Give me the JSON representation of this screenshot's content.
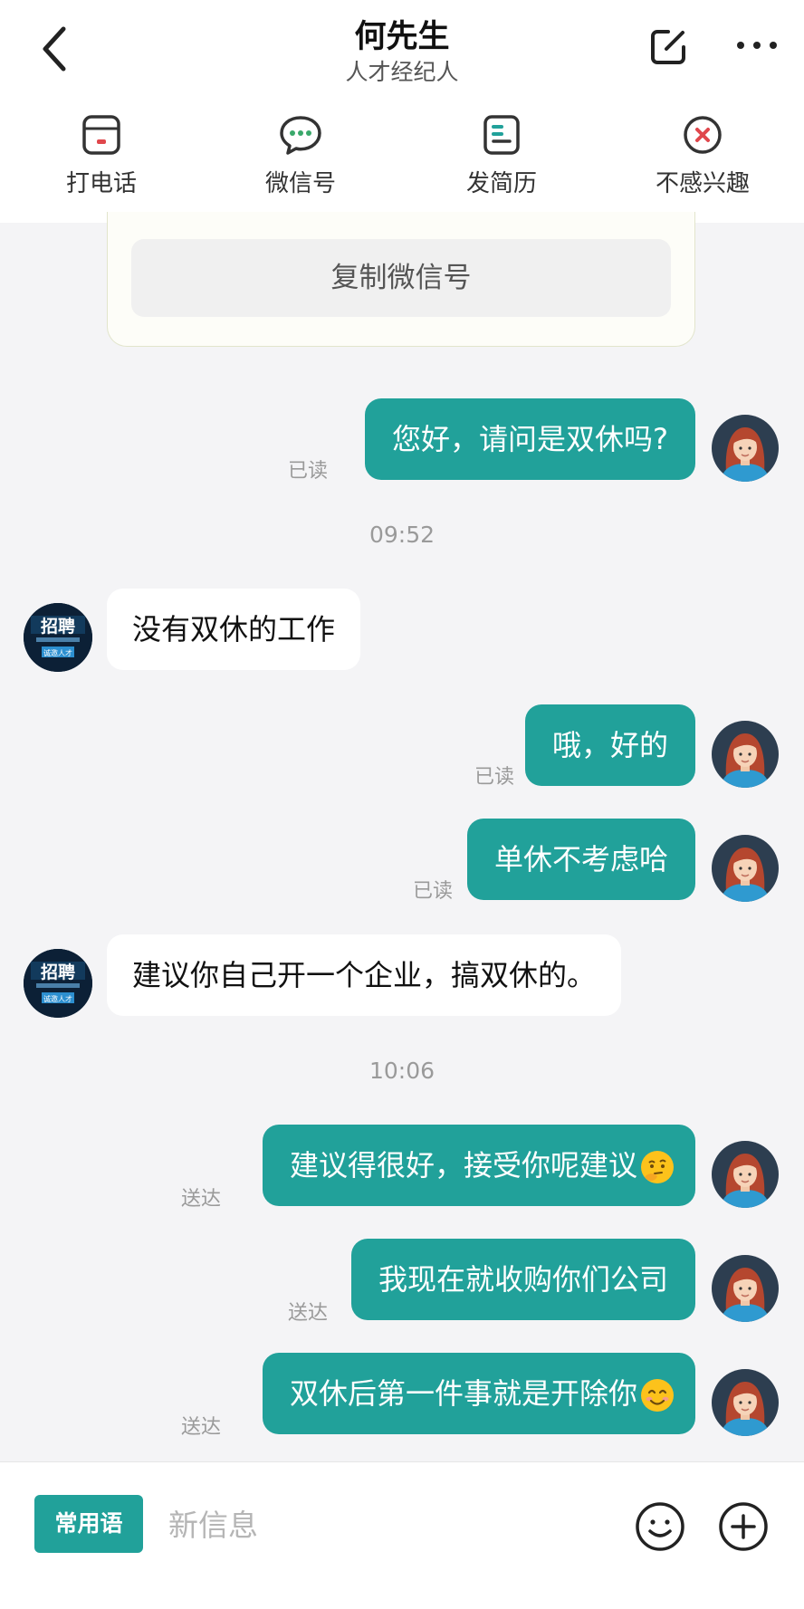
{
  "header": {
    "title": "何先生",
    "subtitle": "人才经纪人"
  },
  "actions": [
    {
      "label": "打电话",
      "icon": "phone-card-icon"
    },
    {
      "label": "微信号",
      "icon": "chat-bubble-icon"
    },
    {
      "label": "发简历",
      "icon": "resume-icon"
    },
    {
      "label": "不感兴趣",
      "icon": "not-interested-icon"
    }
  ],
  "card": {
    "copy_label": "复制微信号"
  },
  "messages": [
    {
      "text": "您好，请问是双休吗?",
      "status": "已读"
    },
    {
      "time": "09:52"
    },
    {
      "text": "没有双休的工作"
    },
    {
      "text": "哦，好的",
      "status": "已读"
    },
    {
      "text": "单休不考虑哈",
      "status": "已读"
    },
    {
      "text": "建议你自己开一个企业，搞双休的。"
    },
    {
      "time": "10:06"
    },
    {
      "text": "建议得很好，接受你呢建议",
      "status": "送达",
      "emoji": "thinking-face-emoji"
    },
    {
      "text": "我现在就收购你们公司",
      "status": "送达"
    },
    {
      "text": "双休后第一件事就是开除你",
      "status": "送达",
      "emoji": "smiling-face-emoji"
    }
  ],
  "avatar_them": {
    "banner_text": "招聘",
    "small_text": "诚邀人才"
  },
  "bottom": {
    "phrases_label": "常用语",
    "input_placeholder": "新信息",
    "input_value": ""
  },
  "colors": {
    "accent": "#21a19a",
    "background": "#f4f4f6",
    "not_interested": "#e0474c"
  }
}
